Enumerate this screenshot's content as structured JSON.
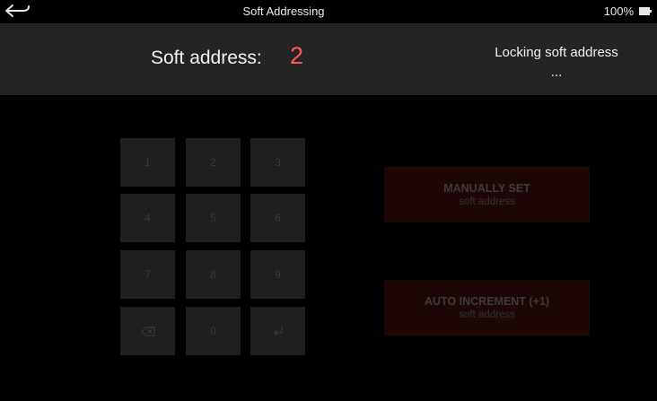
{
  "status_bar": {
    "title": "Soft Addressing",
    "battery": "100%",
    "back_icon": "back-arrow-icon",
    "battery_icon": "battery-icon"
  },
  "header": {
    "address_label": "Soft address:",
    "address_value": "2",
    "lock_line1": "Locking soft address",
    "lock_line2": "..."
  },
  "keypad": {
    "keys": [
      "1",
      "2",
      "3",
      "4",
      "5",
      "6",
      "7",
      "8",
      "9",
      "",
      "0",
      ""
    ],
    "backspace_icon": "backspace-icon",
    "enter_icon": "enter-icon"
  },
  "actions": {
    "manual": {
      "title": "MANUALLY SET",
      "subtitle": "soft address"
    },
    "auto": {
      "title": "AUTO INCREMENT (+1)",
      "subtitle": "soft address"
    }
  },
  "colors": {
    "background": "#000000",
    "header": "#242424",
    "address_value": "#ff5a5a",
    "key": "#1f1f1f",
    "action_button": "#1e0707"
  }
}
